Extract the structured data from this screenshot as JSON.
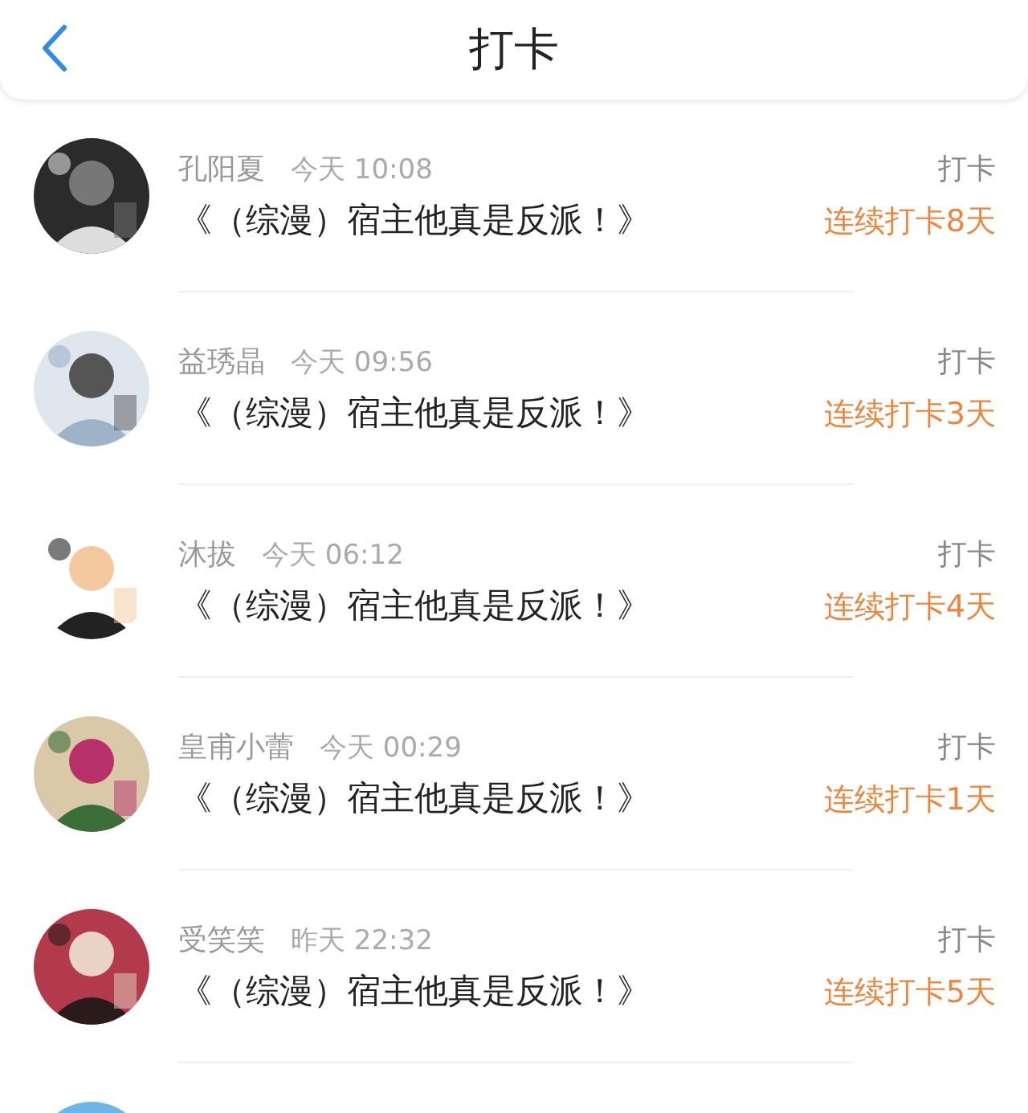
{
  "header": {
    "title": "打卡"
  },
  "entries": [
    {
      "name": "孔阳夏",
      "time": "今天 10:08",
      "book": "《（综漫）宿主他真是反派！》",
      "action": "打卡",
      "streak": "连续打卡8天"
    },
    {
      "name": "益琇晶",
      "time": "今天 09:56",
      "book": "《（综漫）宿主他真是反派！》",
      "action": "打卡",
      "streak": "连续打卡3天"
    },
    {
      "name": "沐拔",
      "time": "今天 06:12",
      "book": "《（综漫）宿主他真是反派！》",
      "action": "打卡",
      "streak": "连续打卡4天"
    },
    {
      "name": "皇甫小蕾",
      "time": "今天 00:29",
      "book": "《（综漫）宿主他真是反派！》",
      "action": "打卡",
      "streak": "连续打卡1天"
    },
    {
      "name": "受笑笑",
      "time": "昨天 22:32",
      "book": "《（综漫）宿主他真是反派！》",
      "action": "打卡",
      "streak": "连续打卡5天"
    }
  ]
}
